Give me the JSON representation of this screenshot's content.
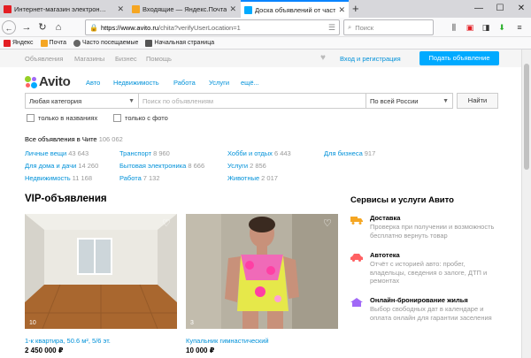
{
  "browser": {
    "tabs": [
      {
        "title": "Интернет-магазин электрон…",
        "favicon_color": "#e31e24"
      },
      {
        "title": "Входящие — Яндекс.Почта",
        "favicon_color": "#f5a623"
      },
      {
        "title": "Доска объявлений от частны…",
        "favicon_color": "#0af"
      }
    ],
    "url_host": "https://www.avito.ru",
    "url_path": "/chita?verifyUserLocation=1",
    "search_placeholder": "Поиск",
    "bookmarks": [
      {
        "label": "Яндекс",
        "color": "#e31e24"
      },
      {
        "label": "Почта",
        "color": "#f5a623"
      },
      {
        "label": "Часто посещаемые",
        "color": "#666"
      },
      {
        "label": "Начальная страница",
        "color": "#555"
      }
    ]
  },
  "avito": {
    "topnav": [
      "Объявления",
      "Магазины",
      "Бизнес",
      "Помощь"
    ],
    "login": "Вход и регистрация",
    "post_ad": "Подать объявление",
    "logo": "Avito",
    "categories": [
      "Авто",
      "Недвижимость",
      "Работа",
      "Услуги",
      "ещё..."
    ],
    "search": {
      "category": "Любая категория",
      "placeholder": "Поиск по объявлениям",
      "region": "По всей России",
      "button": "Найти"
    },
    "checkboxes": [
      "только в названиях",
      "только с фото"
    ],
    "all_ads_label": "Все объявления в Чите",
    "all_ads_count": "106 062",
    "category_links": [
      {
        "label": "Личные вещи",
        "count": "43 643"
      },
      {
        "label": "Транспорт",
        "count": "8 960"
      },
      {
        "label": "Хобби и отдых",
        "count": "6 443"
      },
      {
        "label": "Для бизнеса",
        "count": "917"
      },
      {
        "label": "Для дома и дачи",
        "count": "14 260"
      },
      {
        "label": "Бытовая электроника",
        "count": "8 666"
      },
      {
        "label": "Услуги",
        "count": "2 856"
      },
      {
        "label": "Недвижимость",
        "count": "11 168"
      },
      {
        "label": "Работа",
        "count": "7 132"
      },
      {
        "label": "Животные",
        "count": "2 017"
      }
    ],
    "vip_title": "VIP-объявления",
    "vip_cards": [
      {
        "photo_count": "10",
        "title": "1-к квартира, 50.6 м², 5/6 эт.",
        "price": "2 450 000 ₽"
      },
      {
        "photo_count": "3",
        "title": "Купальник гимнастический",
        "price": "10 000 ₽"
      }
    ],
    "services_title": "Сервисы и услуги Авито",
    "services": [
      {
        "name": "Доставка",
        "desc": "Проверка при получении и возможность бесплатно вернуть товар",
        "icon": "truck-icon"
      },
      {
        "name": "Автотека",
        "desc": "Отчёт с историей авто: пробег, владельцы, сведения о залоге, ДТП и ремонтах",
        "icon": "car-icon"
      },
      {
        "name": "Онлайн-бронирование жилья",
        "desc": "Выбор свободных дат в календаре и оплата онлайн для гарантии заселения",
        "icon": "house-icon"
      }
    ],
    "accent": "#00aaff",
    "link_color": "#0091d9"
  }
}
